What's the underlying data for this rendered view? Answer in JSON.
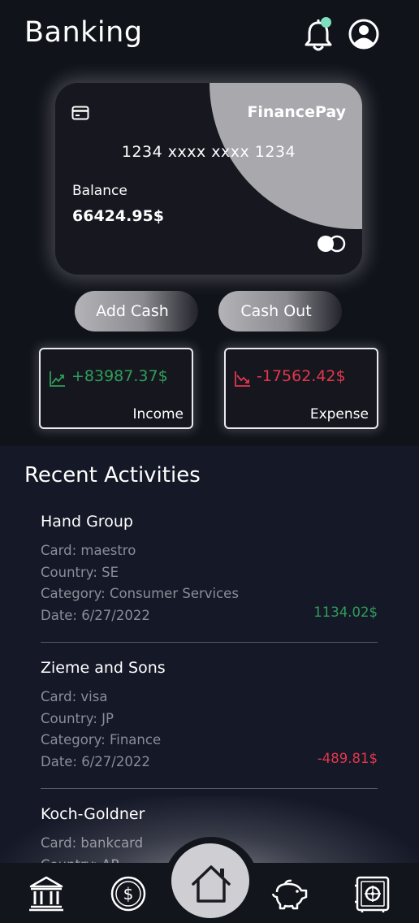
{
  "header": {
    "title": "Banking",
    "notification_dot_color": "#7fe0c1"
  },
  "card": {
    "brand": "FinancePay",
    "number": "1234 xxxx xxxx 1234",
    "balance_label": "Balance",
    "balance_value": "66424.95$"
  },
  "actions": {
    "add_cash": "Add Cash",
    "cash_out": "Cash Out"
  },
  "stats": {
    "income": {
      "value": "+83987.37$",
      "label": "Income",
      "color": "#2f9e5b"
    },
    "expense": {
      "value": "-17562.42$",
      "label": "Expense",
      "color": "#e2374c"
    }
  },
  "recent": {
    "title": "Recent Activities",
    "items": [
      {
        "name": "Hand Group",
        "card": "Card: maestro",
        "country": "Country: SE",
        "category": "Category: Consumer Services",
        "date": "Date: 6/27/2022",
        "amount": "1134.02$"
      },
      {
        "name": "Zieme and Sons",
        "card": "Card: visa",
        "country": "Country: JP",
        "category": "Category: Finance",
        "date": "Date: 6/27/2022",
        "amount": "-489.81$"
      },
      {
        "name": "Koch-Goldner",
        "card": "Card: bankcard",
        "country": "Country: AR"
      }
    ]
  },
  "nav": {
    "items": [
      "bank-icon",
      "dollar-icon",
      "home-icon",
      "piggy-bank-icon",
      "safe-icon"
    ],
    "active": "home-icon"
  }
}
